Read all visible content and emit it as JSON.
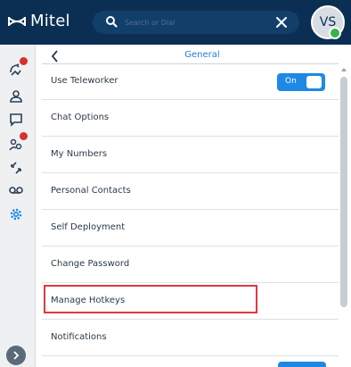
{
  "app": {
    "brand": "Mitel",
    "brand_color": "#0b2f53",
    "accent_color": "#1e88e5"
  },
  "search": {
    "placeholder": "Search or Dial",
    "value": ""
  },
  "user": {
    "initials": "VS",
    "status": "available",
    "status_color": "#35b44a"
  },
  "rail": {
    "items": [
      {
        "icon": "call-history-icon",
        "badge": true
      },
      {
        "icon": "contacts-icon",
        "badge": false
      },
      {
        "icon": "chat-icon",
        "badge": false
      },
      {
        "icon": "groups-icon",
        "badge": true
      },
      {
        "icon": "call-forwarding-icon",
        "badge": false
      },
      {
        "icon": "voicemail-icon",
        "badge": false
      },
      {
        "icon": "settings-icon",
        "badge": false,
        "active": true
      }
    ],
    "expand_icon": "chevron-right-icon"
  },
  "settings": {
    "section_title": "General",
    "items": [
      {
        "label": "Use Teleworker",
        "toggle": "On"
      },
      {
        "label": "Chat Options"
      },
      {
        "label": "My Numbers"
      },
      {
        "label": "Personal Contacts"
      },
      {
        "label": "Self Deployment"
      },
      {
        "label": "Change Password"
      },
      {
        "label": "Manage Hotkeys",
        "highlighted": true
      },
      {
        "label": "Notifications"
      }
    ]
  }
}
